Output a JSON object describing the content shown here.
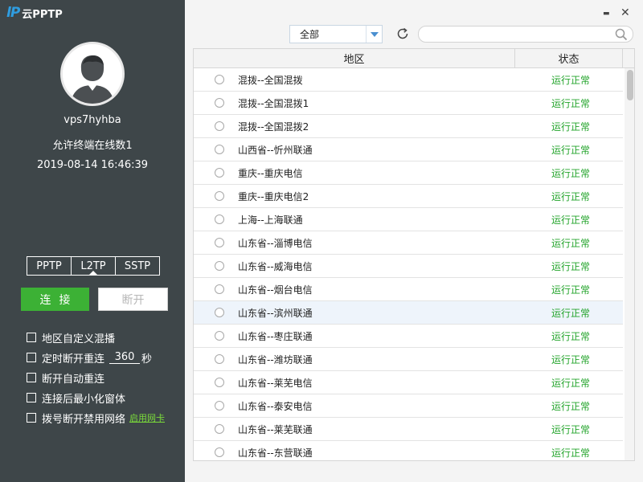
{
  "app": {
    "logo_mark": "lP",
    "logo_text": "云PPTP"
  },
  "user": {
    "name": "vps7hyhba",
    "limit": "允许终端在线数1",
    "expiry": "2019-08-14 16:46:39",
    "avatar_icon": "user-avatar-icon"
  },
  "protocols": [
    "PPTP",
    "L2TP",
    "SSTP"
  ],
  "active_protocol": "L2TP",
  "buttons": {
    "connect": "连接",
    "disconnect": "断开"
  },
  "options": {
    "custom_mix": "地区自定义混播",
    "timed_reconnect_prefix": "定时断开重连",
    "timed_reconnect_value": "360",
    "timed_reconnect_unit": "秒",
    "auto_reconnect": "断开自动重连",
    "minimize_after": "连接后最小化窗体",
    "disable_network": "拨号断开禁用网络",
    "enable_nic": "启用网卡"
  },
  "window": {
    "minimize": "▬",
    "close": "✕"
  },
  "filter": {
    "selected": "全部"
  },
  "search": {
    "placeholder": ""
  },
  "table": {
    "headers": {
      "region": "地区",
      "status": "状态"
    },
    "rows": [
      {
        "name": "混拨--全国混拨",
        "status": "运行正常"
      },
      {
        "name": "混拨--全国混拨1",
        "status": "运行正常"
      },
      {
        "name": "混拨--全国混拨2",
        "status": "运行正常"
      },
      {
        "name": "山西省--忻州联通",
        "status": "运行正常"
      },
      {
        "name": "重庆--重庆电信",
        "status": "运行正常"
      },
      {
        "name": "重庆--重庆电信2",
        "status": "运行正常"
      },
      {
        "name": "上海--上海联通",
        "status": "运行正常"
      },
      {
        "name": "山东省--淄博电信",
        "status": "运行正常"
      },
      {
        "name": "山东省--威海电信",
        "status": "运行正常"
      },
      {
        "name": "山东省--烟台电信",
        "status": "运行正常"
      },
      {
        "name": "山东省--滨州联通",
        "status": "运行正常"
      },
      {
        "name": "山东省--枣庄联通",
        "status": "运行正常"
      },
      {
        "name": "山东省--潍坊联通",
        "status": "运行正常"
      },
      {
        "name": "山东省--莱芜电信",
        "status": "运行正常"
      },
      {
        "name": "山东省--泰安电信",
        "status": "运行正常"
      },
      {
        "name": "山东省--莱芜联通",
        "status": "运行正常"
      },
      {
        "name": "山东省--东营联通",
        "status": "运行正常"
      }
    ],
    "selected_row": 10
  },
  "colors": {
    "sidebar_bg": "#3e4649",
    "accent_green": "#3cb135",
    "status_green": "#23a42b",
    "logo_blue": "#2f9de0",
    "link_green": "#7bdc3a"
  }
}
